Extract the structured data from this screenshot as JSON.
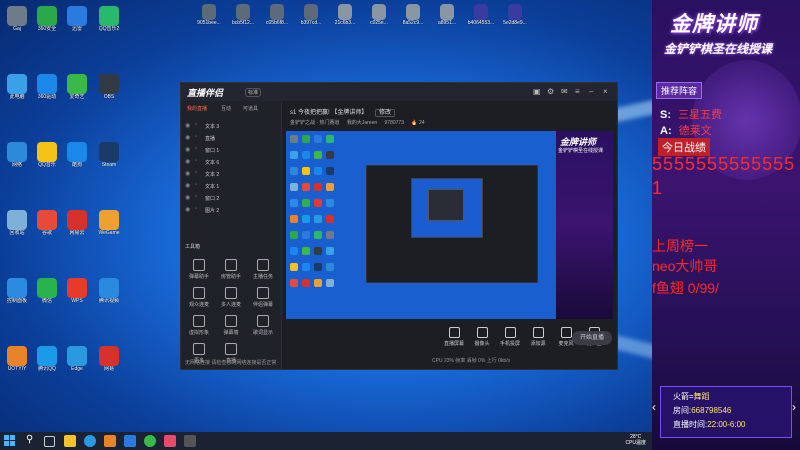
{
  "desktop": {
    "icons": [
      {
        "label": "Gaj",
        "color": "#6e7b8a"
      },
      {
        "label": "此电脑",
        "color": "#3aa0e8"
      },
      {
        "label": "网络",
        "color": "#2d8ad8"
      },
      {
        "label": "回收站",
        "color": "#7fb0d8"
      },
      {
        "label": "控制面板",
        "color": "#2a8be0"
      },
      {
        "label": "UOTYIY",
        "color": "#e8832a"
      },
      {
        "label": "360安全",
        "color": "#2aa84a"
      },
      {
        "label": "360驱动",
        "color": "#1a88e8"
      },
      {
        "label": "QQ音乐",
        "color": "#f5c21a"
      },
      {
        "label": "谷歌",
        "color": "#e84a3a"
      },
      {
        "label": "微信",
        "color": "#2ab34a"
      },
      {
        "label": "腾讯QQ",
        "color": "#1a9ae8"
      },
      {
        "label": "迅雷",
        "color": "#2a7ae0"
      },
      {
        "label": "爱奇艺",
        "color": "#3ab84a"
      },
      {
        "label": "酷狗",
        "color": "#1a88e8"
      },
      {
        "label": "网易云",
        "color": "#d8302a"
      },
      {
        "label": "WPS",
        "color": "#e83a2a"
      },
      {
        "label": "Edge",
        "color": "#2a9ae0"
      },
      {
        "label": "QQ音乐2",
        "color": "#2ab86a"
      },
      {
        "label": "OBS",
        "color": "#333a44"
      },
      {
        "label": "Steam",
        "color": "#1a3a6a"
      },
      {
        "label": "WeGame",
        "color": "#f0a030"
      },
      {
        "label": "腾讯视频",
        "color": "#2a8ae0"
      },
      {
        "label": "网易",
        "color": "#d8302a"
      }
    ],
    "top_files": [
      "9051bee...",
      "bcb5f12...",
      "c05b6f8...",
      "b397cd...",
      "21c6b3...",
      "c025e...",
      "8a52c9...",
      "a8951...",
      "b4064553...",
      "5e2d8e9..."
    ]
  },
  "panel": {
    "title": "金牌讲师",
    "subtitle": "金铲铲棋圣在线授课",
    "tag": "推荐阵容",
    "s_key": "S:",
    "s_value": "三星五费",
    "a_key": "A:",
    "a_value": "德莱文",
    "today_label": "今日战绩",
    "score_digits": "55555555555551",
    "note1": "上周榜一",
    "note2": "neo大帅哥",
    "note3": "f鱼翅 0/99/",
    "info_fire_label": "火箭=",
    "info_fire_value": "舞蹈",
    "info_room_label": "房间:",
    "info_room_value": "668798546",
    "info_time_label": "直播时间:",
    "info_time_value": "22:00-6:00"
  },
  "app": {
    "logo": "直播伴侣",
    "version": "标准",
    "left_tabs": [
      "我的直播",
      "互动",
      "可道具"
    ],
    "layers": [
      "文本 3",
      "直播",
      "窗口 1",
      "文本 6",
      "文本 2",
      "文本 1",
      "窗口 2",
      "图片 2"
    ],
    "tools_header": "工具箱",
    "tools": [
      "弹幕助手",
      "房管助手",
      "主播任务",
      "观众连麦",
      "多人连麦",
      "伴侣弹幕",
      "虚拟形象",
      "弹幕墙",
      "歌词显示",
      "更多",
      "直播"
    ],
    "room_title": "s1 今夜把把赢! 【金牌讲师】",
    "room_title_btn": "修改",
    "room_sub": "金铲铲之战 · 热门赛道",
    "room_sub2": "我的大Jareen",
    "room_id": "9780773",
    "room_count": "24",
    "bottom_buttons": [
      "直播屏幕",
      "摄像头",
      "手机投屏",
      "添加源",
      "麦克风",
      "扬声器"
    ],
    "start_label": "开始直播",
    "status_text": "CPU 23%   帧率   丢帧 0%   上行 0kb/s",
    "left_status": "无网络连接  请检查您的网络连接是否正常"
  },
  "taskbar": {
    "weather_temp": "28°C",
    "weather_text": "CPU温度"
  }
}
